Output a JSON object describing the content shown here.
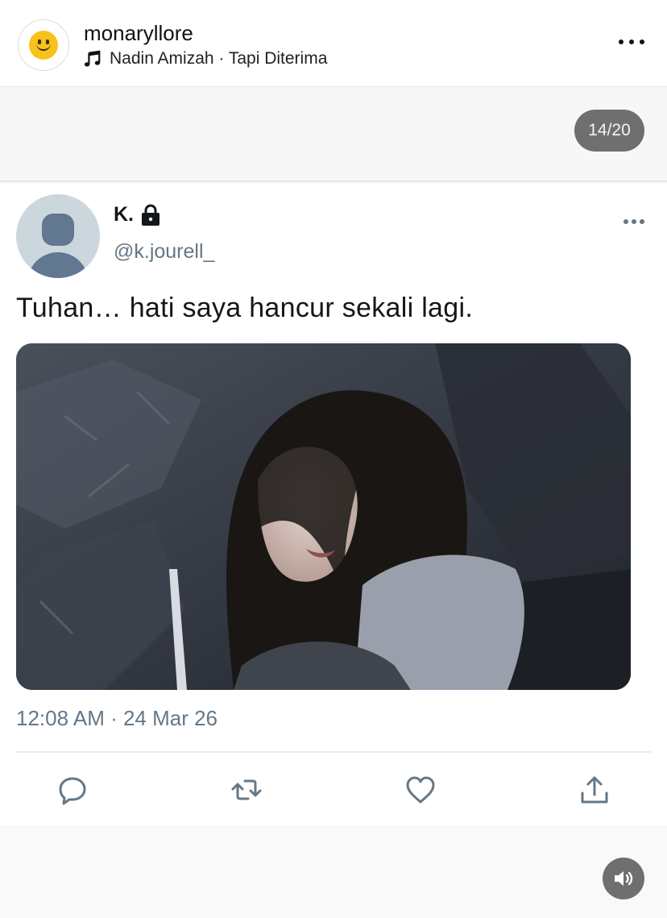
{
  "post": {
    "username": "monaryllore",
    "music": {
      "icon": "music-note-icon",
      "text": "Nadin Amizah · Tapi Diterima"
    },
    "carousel_counter": "14/20"
  },
  "tweet": {
    "display_name": "K.",
    "handle": "@k.jourell_",
    "protected_icon": "lock-icon",
    "text": "Tuhan… hati saya hancur sekali lagi.",
    "timestamp": "12:08 AM · 24 Mar 26",
    "actions": [
      "reply-icon",
      "retweet-icon",
      "like-icon",
      "share-icon"
    ]
  },
  "colors": {
    "tweet_secondary": "#657786",
    "counter_bg": "#6f6f6f",
    "avatar_yellow": "#f7c21b"
  }
}
